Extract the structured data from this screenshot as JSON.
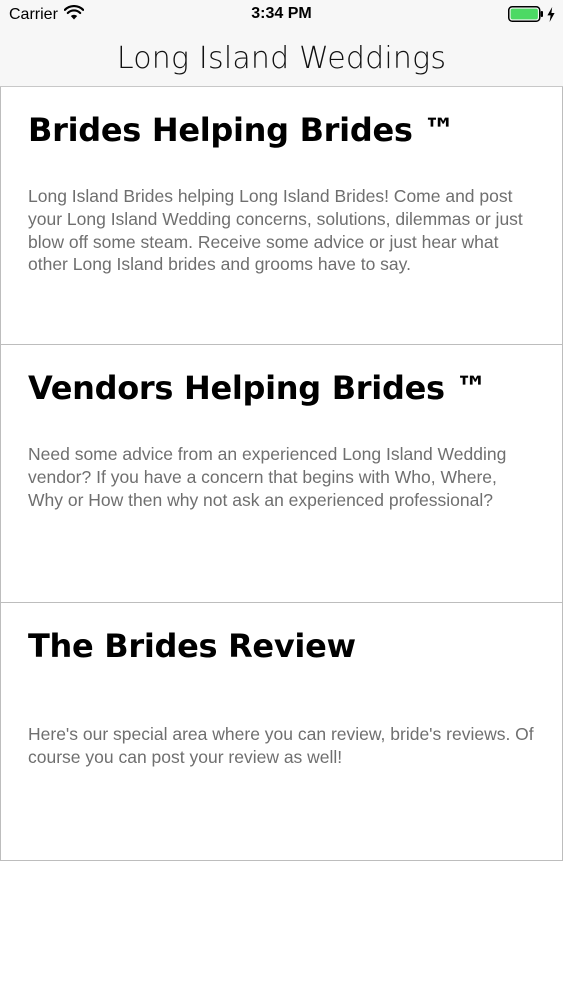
{
  "status_bar": {
    "carrier": "Carrier",
    "time": "3:34 PM",
    "icons": {
      "wifi": "wifi-icon",
      "battery": "battery-icon",
      "charging": "charging-bolt-icon"
    },
    "battery_color": "#4cd964"
  },
  "nav": {
    "title": "Long Island Weddings"
  },
  "cards": [
    {
      "title": "Brides Helping Brides ™",
      "description": "Long Island Brides helping Long Island Brides! Come and post your Long Island Wedding concerns, solutions, dilemmas or just blow off some steam. Receive some advice or just hear what other Long Island brides and grooms have to say."
    },
    {
      "title": "Vendors Helping Brides ™",
      "description": "Need some advice from an experienced Long Island Wedding vendor? If you have a concern that begins with Who, Where, Why or How then why not ask an experienced professional?"
    },
    {
      "title": "The Brides Review",
      "description": "Here's our special area where you can review, bride's reviews.  Of course you can post your review as well!"
    }
  ]
}
